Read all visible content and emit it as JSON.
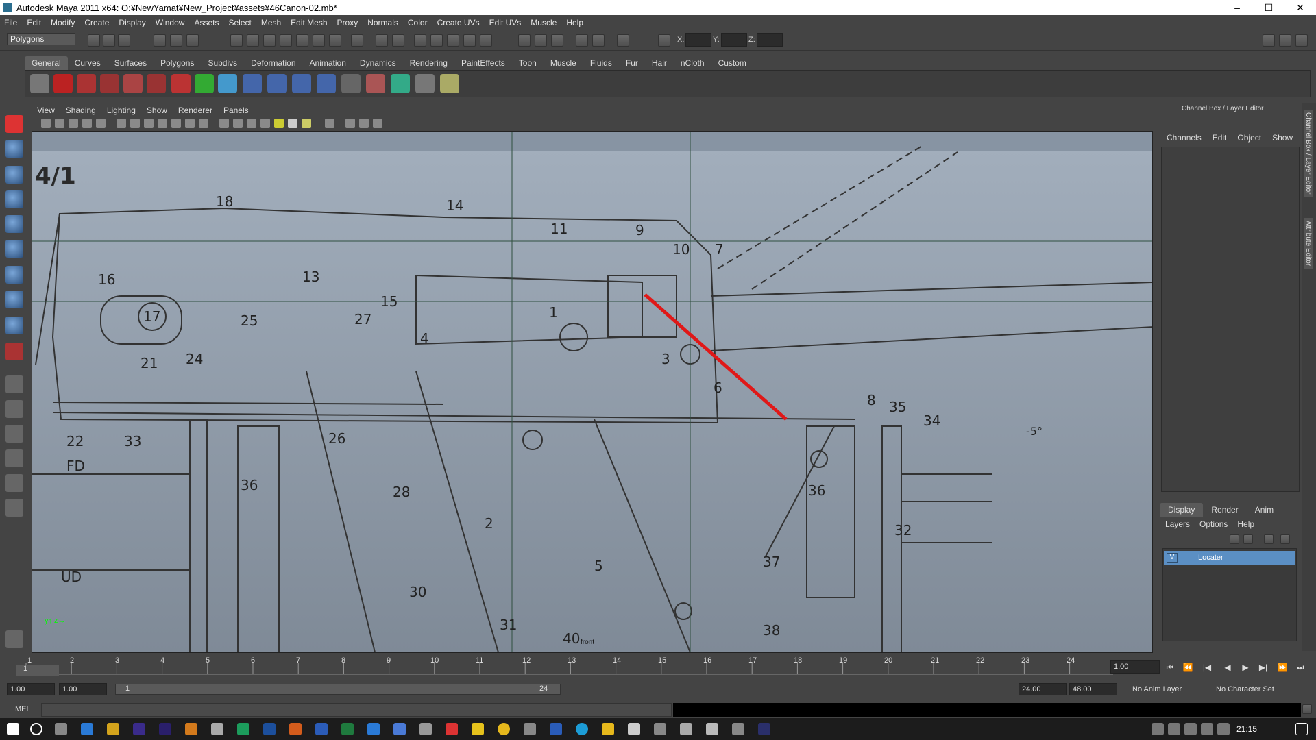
{
  "window": {
    "title": "Autodesk Maya 2011 x64: O:¥NewYamat¥New_Project¥assets¥46Canon-02.mb*",
    "minimize": "–",
    "maximize": "☐",
    "close": "✕"
  },
  "menubar": [
    "File",
    "Edit",
    "Modify",
    "Create",
    "Display",
    "Window",
    "Assets",
    "Select",
    "Mesh",
    "Edit Mesh",
    "Proxy",
    "Normals",
    "Color",
    "Create UVs",
    "Edit UVs",
    "Muscle",
    "Help"
  ],
  "status": {
    "mode": "Polygons",
    "x_label": "X:",
    "y_label": "Y:",
    "z_label": "Z:"
  },
  "shelf": {
    "tabs": [
      "General",
      "Curves",
      "Surfaces",
      "Polygons",
      "Subdivs",
      "Deformation",
      "Animation",
      "Dynamics",
      "Rendering",
      "PaintEffects",
      "Toon",
      "Muscle",
      "Fluids",
      "Fur",
      "Hair",
      "nCloth",
      "Custom"
    ],
    "active": "General"
  },
  "viewport": {
    "menu": [
      "View",
      "Shading",
      "Lighting",
      "Show",
      "Renderer",
      "Panels"
    ],
    "camera": "front",
    "axis": "y↑ z→",
    "image_labels": {
      "sheet": "4/1",
      "n18": "18",
      "n14": "14",
      "n11": "11",
      "n9": "9",
      "n10": "10",
      "n7": "7",
      "n16": "16",
      "n13": "13",
      "n17": "17",
      "n15": "15",
      "n25": "25",
      "n27": "27",
      "n1": "1",
      "n4": "4",
      "n21": "21",
      "n24": "24",
      "n3": "3",
      "n6": "6",
      "n8": "8",
      "n35": "35",
      "n34": "34",
      "n22": "22",
      "n33": "33",
      "n26": "26",
      "fd": "FD",
      "n36a": "36",
      "n36b": "36",
      "n28": "28",
      "n2": "2",
      "n32": "32",
      "n5": "5",
      "n37": "37",
      "ud": "UD",
      "n30": "30",
      "n31": "31",
      "n40": "40",
      "n38": "38",
      "deg": "-5°"
    }
  },
  "channel_box": {
    "title": "Channel Box / Layer Editor",
    "menu": [
      "Channels",
      "Edit",
      "Object",
      "Show"
    ]
  },
  "side_tabs": [
    "Channel Box / Layer Editor",
    "Attribute Editor"
  ],
  "layer_editor": {
    "tabs": [
      "Display",
      "Render",
      "Anim"
    ],
    "active": "Display",
    "menu": [
      "Layers",
      "Options",
      "Help"
    ],
    "layers": [
      {
        "visible": "V",
        "name": "Locater"
      }
    ]
  },
  "timeline": {
    "ticks": [
      "1",
      "2",
      "3",
      "4",
      "5",
      "6",
      "7",
      "8",
      "9",
      "10",
      "11",
      "12",
      "13",
      "14",
      "15",
      "16",
      "17",
      "18",
      "19",
      "20",
      "21",
      "22",
      "23",
      "24"
    ],
    "current": "1.00",
    "current_frame_marker": "1"
  },
  "range": {
    "start": "1.00",
    "playback_start": "1.00",
    "slider_start": "1",
    "slider_end": "24",
    "playback_end": "24.00",
    "end": "48.00",
    "anim_layer": "No Anim Layer",
    "character_set": "No Character Set"
  },
  "cmdline": {
    "label": "MEL"
  },
  "taskbar": {
    "time": "21:15"
  },
  "colors": {
    "accent": "#5b8fc4",
    "red_line": "#e01818"
  }
}
